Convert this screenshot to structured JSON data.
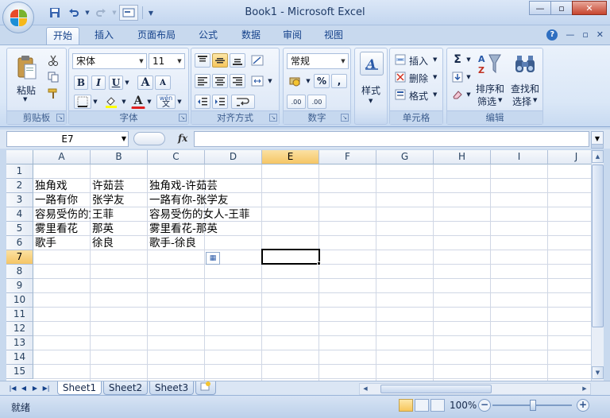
{
  "window": {
    "title": "Book1 - Microsoft Excel",
    "min_glyph": "—",
    "restore_glyph": "▫",
    "close_glyph": "✕"
  },
  "ribbon_tabs": [
    "开始",
    "插入",
    "页面布局",
    "公式",
    "数据",
    "审阅",
    "视图"
  ],
  "ribbon": {
    "clipboard": {
      "label": "剪贴板",
      "paste": "粘贴"
    },
    "font": {
      "label": "字体",
      "name": "宋体",
      "size": "11",
      "bold": "B",
      "italic": "I",
      "underline": "U",
      "grow": "A",
      "shrink": "A",
      "font_color": "A",
      "phonetic": "wén"
    },
    "alignment": {
      "label": "对齐方式"
    },
    "number": {
      "label": "数字",
      "format": "常规",
      "percent": "%",
      "comma": ",",
      "inc_decimal": ".00",
      "dec_decimal": ".00"
    },
    "styles": {
      "label": "样式"
    },
    "cells": {
      "label": "单元格",
      "insert": "插入",
      "delete": "删除",
      "format": "格式"
    },
    "editing": {
      "label": "编辑",
      "sigma": "Σ",
      "sort_filter_1": "排序和",
      "sort_filter_2": "筛选",
      "find_select_1": "查找和",
      "find_select_2": "选择"
    }
  },
  "formula_bar": {
    "name_box": "E7",
    "fx": "fx",
    "formula": ""
  },
  "columns": [
    "A",
    "B",
    "C",
    "D",
    "E",
    "F",
    "G",
    "H",
    "I",
    "J"
  ],
  "rows": [
    "1",
    "2",
    "3",
    "4",
    "5",
    "6",
    "7",
    "8",
    "9",
    "10",
    "11",
    "12",
    "13",
    "14",
    "15"
  ],
  "cells": {
    "A2": "独角戏",
    "B2": "许茹芸",
    "C2": "独角戏-许茹芸",
    "A3": "一路有你",
    "B3": "张学友",
    "C3": "一路有你-张学友",
    "A4": "容易受伤的女人",
    "B4": "王菲",
    "C4": "容易受伤的女人-王菲",
    "A5": "雾里看花",
    "B5": "那英",
    "C5": "雾里看花-那英",
    "A6": "歌手",
    "B6": "徐良",
    "C6": "歌手-徐良"
  },
  "active_cell": "E7",
  "sheets": [
    "Sheet1",
    "Sheet2",
    "Sheet3"
  ],
  "active_sheet": "Sheet1",
  "status": {
    "text": "就绪",
    "zoom": "100%"
  },
  "colors": {
    "accent": "#15428b",
    "selected_header": "#f5c565"
  }
}
